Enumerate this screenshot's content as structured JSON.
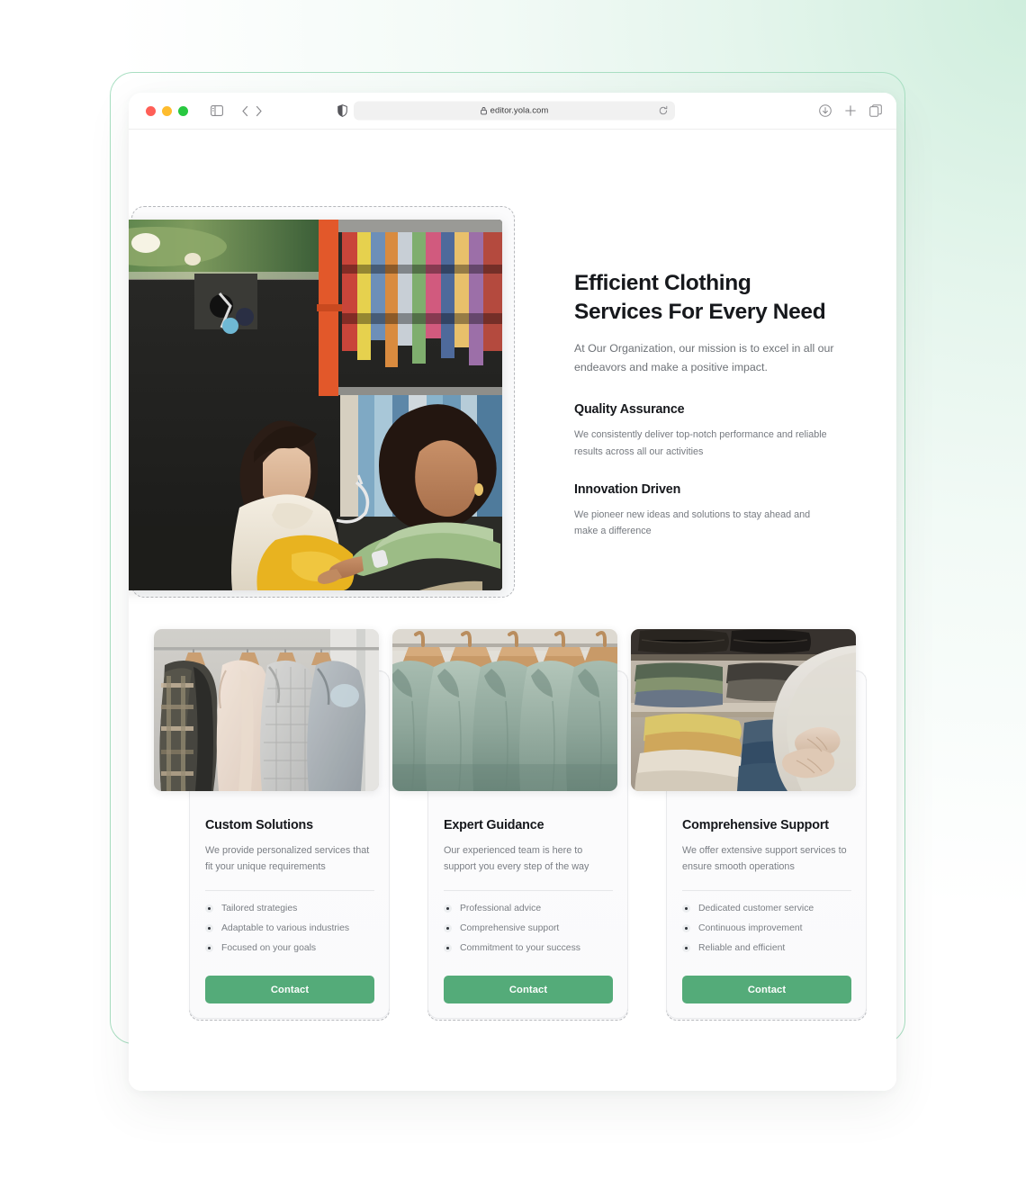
{
  "browser": {
    "url": "editor.yola.com",
    "traffic_lights": [
      "close",
      "minimize",
      "maximize"
    ],
    "icons": {
      "sidebar_toggle": "sidebar-toggle-icon",
      "back": "chevron-left-icon",
      "forward": "chevron-right-icon",
      "shield": "shield-icon",
      "lock": "lock-icon",
      "reload": "reload-icon",
      "download": "download-icon",
      "new_tab": "plus-icon",
      "tab_overview": "tab-overview-icon"
    }
  },
  "hero": {
    "title_line1": "Efficient Clothing",
    "title_line2": "Services For Every Need",
    "subtitle": "At Our Organization, our mission is to excel in all our endeavors and make a positive impact.",
    "image_alt": "Two women browsing colorful clothing racks in a thrift store",
    "features": [
      {
        "title": "Quality Assurance",
        "body": "We consistently deliver top-notch performance and reliable results across all our activities"
      },
      {
        "title": "Innovation Driven",
        "body": "We pioneer new ideas and solutions to stay ahead and make a difference"
      }
    ]
  },
  "cards": [
    {
      "image_alt": "Coats and jackets hanging on a clothing rail",
      "title": "Custom Solutions",
      "description": "We provide personalized services that fit your unique requirements",
      "list": [
        "Tailored strategies",
        "Adaptable to various industries",
        "Focused on your goals"
      ],
      "button": "Contact"
    },
    {
      "image_alt": "Row of sage green shirts on wooden hangers",
      "title": "Expert Guidance",
      "description": "Our experienced team is here to support you every step of the way",
      "list": [
        "Professional advice",
        "Comprehensive support",
        "Commitment to your success"
      ],
      "button": "Contact"
    },
    {
      "image_alt": "Hands folding and sorting clothes on a closet shelf",
      "title": "Comprehensive Support",
      "description": "We offer extensive support services to ensure smooth operations",
      "list": [
        "Dedicated customer service",
        "Continuous improvement",
        "Reliable and efficient"
      ],
      "button": "Contact"
    }
  ],
  "colors": {
    "accent_green": "#54ab79",
    "frame_green": "#a9dfc2",
    "heading": "#16181c",
    "body_text": "#7a7e84",
    "selection_dash": "#b9bbbf"
  }
}
